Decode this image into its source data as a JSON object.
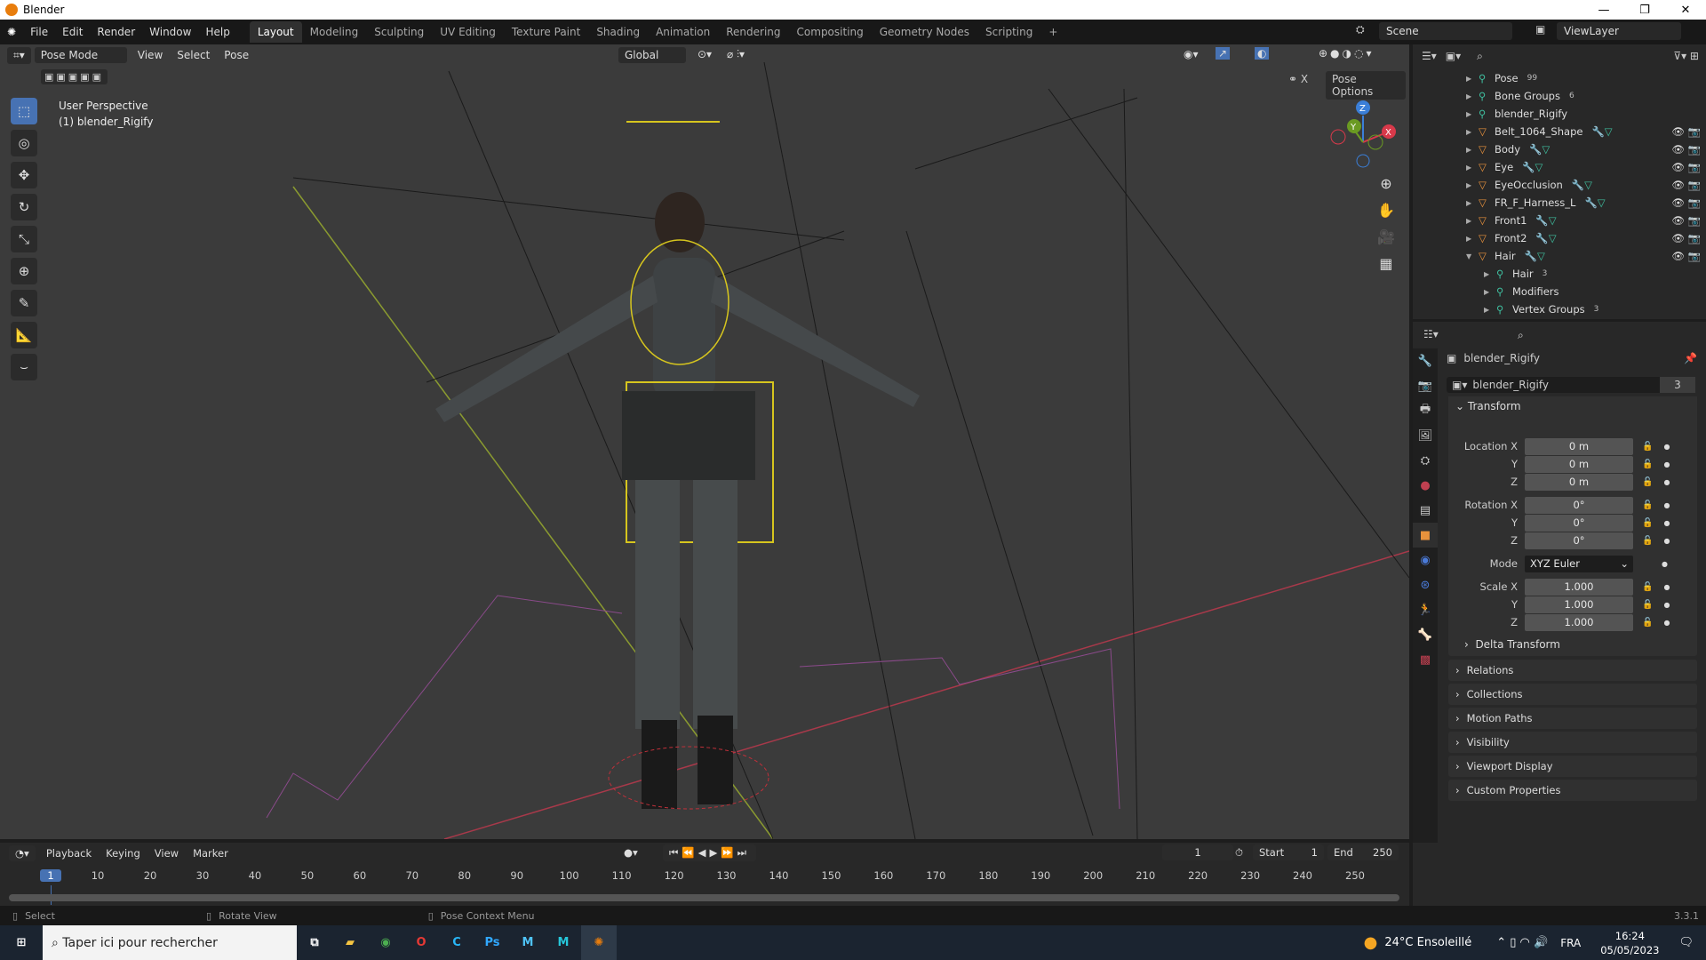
{
  "window": {
    "title": "Blender",
    "controls": [
      "—",
      "❐",
      "✕"
    ]
  },
  "menu": [
    "File",
    "Edit",
    "Render",
    "Window",
    "Help"
  ],
  "workspaces": [
    "Layout",
    "Modeling",
    "Sculpting",
    "UV Editing",
    "Texture Paint",
    "Shading",
    "Animation",
    "Rendering",
    "Compositing",
    "Geometry Nodes",
    "Scripting",
    "+"
  ],
  "scene": {
    "name": "Scene",
    "view_layer": "ViewLayer"
  },
  "viewport": {
    "mode": "Pose Mode",
    "menus": [
      "View",
      "Select",
      "Pose"
    ],
    "orientation": "Global",
    "pose_options": "Pose Options",
    "overlay_title": "User Perspective",
    "overlay_object": "(1) blender_Rigify",
    "gizmo": {
      "x": "X",
      "y": "Y",
      "z": "Z"
    }
  },
  "outliner": {
    "items": [
      {
        "name": "Pose",
        "badge": "99",
        "indent": 0
      },
      {
        "name": "Bone Groups",
        "badge": "6",
        "indent": 0
      },
      {
        "name": "blender_Rigify",
        "indent": 0
      },
      {
        "name": "Belt_1064_Shape",
        "mesh": true,
        "indent": 0
      },
      {
        "name": "Body",
        "mesh": true,
        "indent": 0
      },
      {
        "name": "Eye",
        "mesh": true,
        "indent": 0
      },
      {
        "name": "EyeOcclusion",
        "mesh": true,
        "indent": 0
      },
      {
        "name": "FR_F_Harness_L",
        "mesh": true,
        "indent": 0
      },
      {
        "name": "Front1",
        "mesh": true,
        "indent": 0
      },
      {
        "name": "Front2",
        "mesh": true,
        "indent": 0
      },
      {
        "name": "Hair",
        "mesh": true,
        "indent": 0,
        "expanded": true
      },
      {
        "name": "Hair",
        "badge": "3",
        "indent": 1
      },
      {
        "name": "Modifiers",
        "indent": 1
      },
      {
        "name": "Vertex Groups",
        "badge": "3",
        "indent": 1
      }
    ]
  },
  "properties": {
    "object_name": "blender_Rigify",
    "data_name": "blender_Rigify",
    "users": "3",
    "transform_label": "Transform",
    "location": {
      "label": "Location X",
      "x": "0 m",
      "y": "0 m",
      "z": "0 m"
    },
    "rotation": {
      "label": "Rotation X",
      "x": "0°",
      "y": "0°",
      "z": "0°"
    },
    "mode": {
      "label": "Mode",
      "value": "XYZ Euler"
    },
    "scale": {
      "label": "Scale X",
      "x": "1.000",
      "y": "1.000",
      "z": "1.000"
    },
    "axis": {
      "y": "Y",
      "z": "Z"
    },
    "delta": "Delta Transform",
    "panels": [
      "Relations",
      "Collections",
      "Motion Paths",
      "Visibility",
      "Viewport Display",
      "Custom Properties"
    ]
  },
  "timeline": {
    "menus": [
      "Playback",
      "Keying",
      "View",
      "Marker"
    ],
    "current_frame": "1",
    "start_label": "Start",
    "start": "1",
    "end_label": "End",
    "end": "250",
    "ticks": [
      "1",
      "10",
      "20",
      "30",
      "40",
      "50",
      "60",
      "70",
      "80",
      "90",
      "100",
      "110",
      "120",
      "130",
      "140",
      "150",
      "160",
      "170",
      "180",
      "190",
      "200",
      "210",
      "220",
      "230",
      "240",
      "250"
    ]
  },
  "status": {
    "select": "Select",
    "rotate": "Rotate View",
    "context": "Pose Context Menu",
    "version": "3.3.1"
  },
  "taskbar": {
    "search_placeholder": "Taper ici pour rechercher",
    "weather": "24°C  Ensoleillé",
    "lang": "FRA",
    "time": "16:24",
    "date": "05/05/2023"
  },
  "colors": {
    "accent": "#4772b3",
    "mesh": "#e8923c"
  }
}
